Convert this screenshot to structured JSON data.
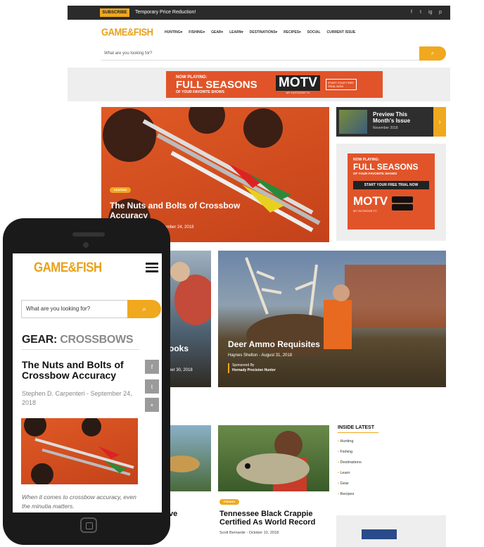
{
  "topbar": {
    "subscribe": "SUBSCRIBE",
    "promo": "Temporary Price Reduction!",
    "social": [
      "f",
      "t",
      "ig",
      "p"
    ]
  },
  "logo": "GAME&FISH",
  "nav": [
    "HUNTING▾",
    "FISHING▾",
    "GEAR▾",
    "LEARN▾",
    "DESTINATIONS▾",
    "RECIPES▾",
    "SOCIAL",
    "CURRENT ISSUE"
  ],
  "search": {
    "placeholder": "What are you looking for?",
    "icon": "search-icon"
  },
  "ad_banner": {
    "line1": "NOW PLAYING:",
    "line2": "FULL SEASONS",
    "line3": "OF YOUR FAVORITE SHOWS",
    "brand": "MOTV",
    "brand_sub": "MY OUTDOOR TV",
    "cta": "START YOUR FREE TRIAL NOW"
  },
  "hero": {
    "badge": "HUNTING",
    "title": "The Nuts and Bolts of Crossbow Accuracy",
    "byline": "Stephen D. Carpenteri - September 24, 2018"
  },
  "preview": {
    "title": "Preview This Month's Issue",
    "date": "November 2018"
  },
  "side_ad": {
    "line1": "NOW PLAYING:",
    "line2": "FULL SEASONS",
    "line3": "OF YOUR FAVORITE SHOWS",
    "cta": "START YOUR FREE TRIAL NOW",
    "brand": "MOTV",
    "brand_sub": "MY OUTDOOR TV"
  },
  "left_card": {
    "title_fragment": "ooks",
    "date_fragment": "ber 30, 2018"
  },
  "deer": {
    "title": "Deer Ammo Requisites",
    "byline": "Haynes Shelton - August 31, 2018",
    "sponsor_label": "Sponsored By",
    "sponsor": "Hornady Precision Hunter"
  },
  "crappie": {
    "badge": "FISHING",
    "title": "Tennessee Black Crappie Certified As World Record",
    "byline": "Scott Bernarde - October 10, 2018"
  },
  "row3_left_fragment": "ve",
  "inside": {
    "heading": "INSIDE LATEST",
    "items": [
      "Hunting",
      "Fishing",
      "Destinations",
      "Learn",
      "Gear",
      "Recipes"
    ]
  },
  "mobile": {
    "logo": "GAME&FISH",
    "search_placeholder": "What are you looking for?",
    "category_prefix": "GEAR:",
    "category": "CROSSBOWS",
    "title": "The Nuts and Bolts of Crossbow Accuracy",
    "byline": "Stephen D. Carpenteri - September 24, 2018",
    "lead": "When it comes to crossbow accuracy, even the minutia matters.",
    "share": [
      "f",
      "t",
      "+"
    ]
  },
  "colors": {
    "accent": "#f0a81e",
    "ad_orange": "#e1542a",
    "dark": "#2b2b2b"
  }
}
